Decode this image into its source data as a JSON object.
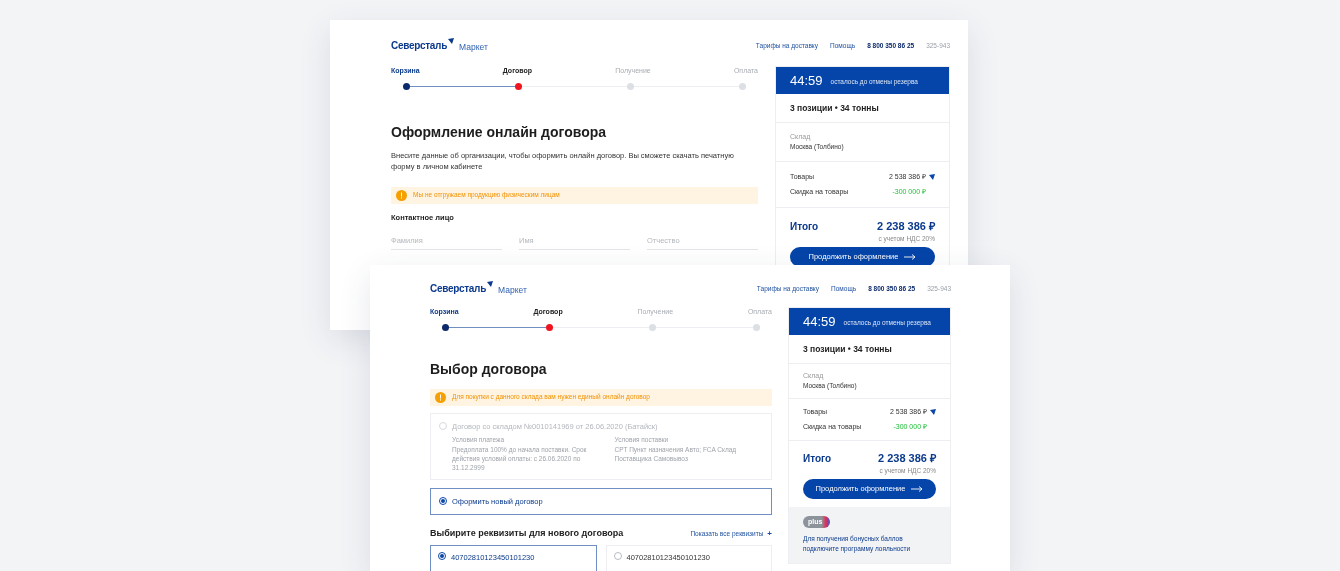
{
  "screens": [
    {
      "header": {
        "brand": "Северсталь",
        "brand_suffix": "Маркет",
        "links": [
          "Тарифы на доставку",
          "Помощь"
        ],
        "phone": "8 800 350 86 25",
        "code": "325-943"
      },
      "steps": [
        {
          "label": "Корзина",
          "completed": true,
          "selected": false
        },
        {
          "label": "Договор",
          "completed": false,
          "selected": true
        },
        {
          "label": "Получение",
          "completed": false,
          "selected": false
        },
        {
          "label": "Оплата",
          "completed": false,
          "selected": false
        }
      ],
      "main": {
        "title": "Оформление онлайн договора",
        "description": "Внесите данные об организации, чтобы оформить онлайн договор. Вы сможете скачать печатную форму в личном кабинете",
        "notice": "Мы не отгружаем продукцию физическим лицам",
        "contact": {
          "title": "Контактное лицо",
          "fields": [
            {
              "placeholder": "Фамилия"
            },
            {
              "placeholder": "Имя"
            },
            {
              "placeholder": "Отчество"
            }
          ]
        }
      },
      "summary": {
        "timer": "44:59",
        "timer_note": "осталось до отмены резерва",
        "positions": "3 позиции • 34 тонны",
        "warehouse_label": "Склад",
        "warehouse": "Москва (Толбино)",
        "lines": [
          {
            "label": "Товары",
            "value": "2 538 386 ₽",
            "kind": "price"
          },
          {
            "label": "Скидка на товары",
            "value": "-300 000 ₽",
            "kind": "discount"
          }
        ],
        "total_label": "Итого",
        "total": "2 238 386 ₽",
        "vat": "с учетом НДС 20%",
        "button": "Продолжить оформление"
      }
    },
    {
      "header": {
        "brand": "Северсталь",
        "brand_suffix": "Маркет",
        "links": [
          "Тарифы на доставку",
          "Помощь"
        ],
        "phone": "8 800 350 86 25",
        "code": "325-943"
      },
      "steps": [
        {
          "label": "Корзина",
          "completed": true,
          "selected": false
        },
        {
          "label": "Договор",
          "completed": false,
          "selected": true
        },
        {
          "label": "Получение",
          "completed": false,
          "selected": false
        },
        {
          "label": "Оплата",
          "completed": false,
          "selected": false
        }
      ],
      "main": {
        "title": "Выбор договора",
        "notice": "Для покупки с данного склада вам нужен единый онлайн договор",
        "contracts": [
          {
            "title": "Договор со складом №0010141969 от 26.06.2020 (Батайск)",
            "selected": false,
            "disabled": true,
            "details": [
              {
                "label": "Условия платежа",
                "text": "Предоплата 100% до начала поставки. Срок действия условий оплаты: с 26.06.2020 по 31.12.2999"
              },
              {
                "label": "Условия поставки",
                "text": "CPT Пункт назначения Авто; FCA Склад Поставщика Самовывоз"
              }
            ]
          },
          {
            "title": "Оформить новый договор",
            "selected": true,
            "disabled": false
          }
        ],
        "requisites": {
          "title": "Выбирите реквизиты для нового договора",
          "link": "Показать все реквизиты",
          "link_icon": "+",
          "accounts": [
            {
              "number": "40702810123450101230",
              "selected": true
            },
            {
              "number": "40702810123450101230",
              "selected": false
            }
          ]
        }
      },
      "summary": {
        "timer": "44:59",
        "timer_note": "осталось до отмены резерва",
        "positions": "3 позиции • 34 тонны",
        "warehouse_label": "Склад",
        "warehouse": "Москва (Толбино)",
        "lines": [
          {
            "label": "Товары",
            "value": "2 538 386 ₽",
            "kind": "price"
          },
          {
            "label": "Скидка на товары",
            "value": "-300 000 ₽",
            "kind": "discount"
          }
        ],
        "total_label": "Итого",
        "total": "2 238 386 ₽",
        "vat": "с учетом НДС 20%",
        "button": "Продолжить оформление",
        "loyalty": {
          "badge": "plus",
          "text": "Для получения бонусных баллов подключите программу лояльности"
        }
      }
    }
  ]
}
